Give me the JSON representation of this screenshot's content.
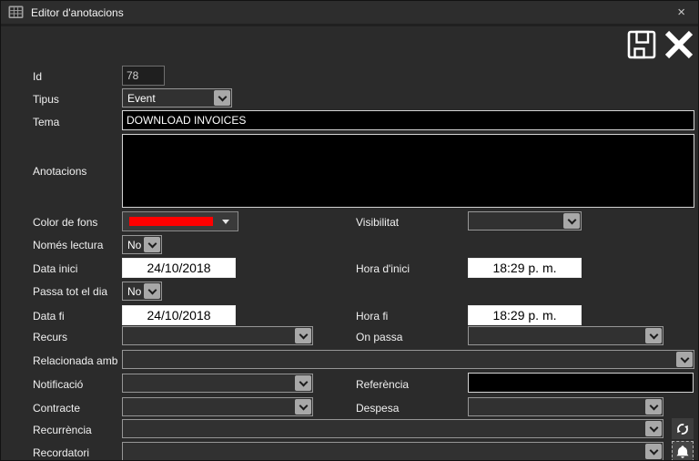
{
  "window": {
    "title": "Editor d'anotacions",
    "close_glyph": "×"
  },
  "icons": {
    "titlebar": "table-grid-icon",
    "save": "floppy-disk-icon",
    "cancel": "x-icon",
    "recurrence": "refresh-icon",
    "reminder": "bell-icon",
    "combo_arrow": "chevron-down-icon"
  },
  "colors": {
    "window_bg": "#2b2b2b",
    "titlebar_bg": "#2d2d2d",
    "field_bg_black": "#000000",
    "field_bg_white": "#ffffff",
    "swatch_red": "#ff0000"
  },
  "fields": {
    "id": {
      "label": "Id",
      "value": "78"
    },
    "tipus": {
      "label": "Tipus",
      "value": "Event"
    },
    "tema": {
      "label": "Tema",
      "value": "DOWNLOAD INVOICES"
    },
    "anotacions": {
      "label": "Anotacions",
      "value": ""
    },
    "color_de_fons": {
      "label": "Color de fons",
      "color": "#ff0000"
    },
    "visibilitat": {
      "label": "Visibilitat",
      "value": ""
    },
    "nomes_lectura": {
      "label": "Només lectura",
      "value": "No"
    },
    "data_inici": {
      "label": "Data inici",
      "value": "24/10/2018"
    },
    "hora_inici": {
      "label": "Hora d'inici",
      "value": "18:29 p. m."
    },
    "passa_tot_el_dia": {
      "label": "Passa tot el dia",
      "value": "No"
    },
    "data_fi": {
      "label": "Data fi",
      "value": "24/10/2018"
    },
    "hora_fi": {
      "label": "Hora fi",
      "value": "18:29 p. m."
    },
    "recurs": {
      "label": "Recurs",
      "value": ""
    },
    "on_passa": {
      "label": "On passa",
      "value": ""
    },
    "relacionada_amb": {
      "label": "Relacionada amb",
      "value": ""
    },
    "notificacio": {
      "label": "Notificació",
      "value": ""
    },
    "referencia": {
      "label": "Referència",
      "value": ""
    },
    "contracte": {
      "label": "Contracte",
      "value": ""
    },
    "despesa": {
      "label": "Despesa",
      "value": ""
    },
    "recurrencia": {
      "label": "Recurrència",
      "value": ""
    },
    "recordatori": {
      "label": "Recordatori",
      "value": ""
    }
  }
}
